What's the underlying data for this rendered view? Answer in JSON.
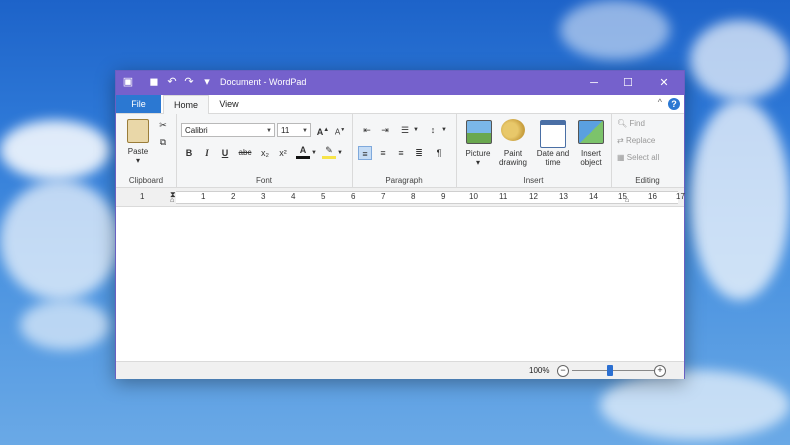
{
  "window": {
    "title": "Document - WordPad",
    "minimize_icon": "minimize-icon",
    "maximize_icon": "maximize-icon",
    "close_icon": "close-icon"
  },
  "quick_access": [
    "app-icon",
    "save-icon",
    "undo-icon",
    "redo-icon",
    "customize-quick-access-icon"
  ],
  "tabs": [
    {
      "label": "File",
      "active": false
    },
    {
      "label": "Home",
      "active": true
    },
    {
      "label": "View",
      "active": false
    }
  ],
  "ribbon": {
    "clipboard": {
      "paste_label": "Paste",
      "group_label": "Clipboard"
    },
    "font": {
      "family": "Calibri",
      "size": "11",
      "group_label": "Font",
      "buttons": [
        "B",
        "I",
        "U",
        "abc",
        "x₂",
        "x²"
      ]
    },
    "paragraph": {
      "group_label": "Paragraph"
    },
    "insert": {
      "group_label": "Insert",
      "picture_label": "Picture",
      "paint_label1": "Paint",
      "paint_label2": "drawing",
      "date_label1": "Date and",
      "date_label2": "time",
      "object_label1": "Insert",
      "object_label2": "object"
    },
    "editing": {
      "group_label": "Editing",
      "find_label": "Find",
      "replace_label": "Replace",
      "select_all_label": "Select all"
    }
  },
  "ruler": {
    "numbers": [
      "1",
      "1",
      "2",
      "3",
      "4",
      "5",
      "6",
      "7",
      "8",
      "9",
      "10",
      "11",
      "12",
      "13",
      "14",
      "15",
      "16",
      "17"
    ]
  },
  "status": {
    "zoom": "100%",
    "zoom_level_percent": 100
  },
  "colors": {
    "titlebar": "#7561cc",
    "file_tab": "#2b78d2",
    "ribbon": "#f5f6f7"
  }
}
